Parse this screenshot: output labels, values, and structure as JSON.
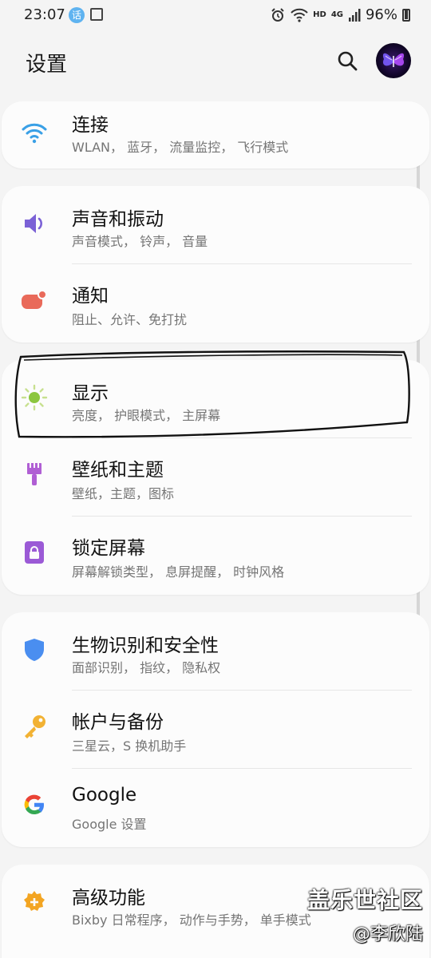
{
  "status": {
    "time": "23:07",
    "battery": "96%",
    "network_labels": [
      "HD",
      "4G"
    ]
  },
  "header": {
    "title": "设置"
  },
  "cards": [
    {
      "items": [
        {
          "label": "连接",
          "subtitle": "WLAN， 蓝牙， 流量监控， 飞行模式",
          "icon": "wifi-icon",
          "icon_color": "#3aa0e6"
        }
      ]
    },
    {
      "items": [
        {
          "label": "声音和振动",
          "subtitle": "声音模式， 铃声， 音量",
          "icon": "speaker-icon",
          "icon_color": "#7b61d6"
        },
        {
          "label": "通知",
          "subtitle": "阻止、允许、免打扰",
          "icon": "notification-icon",
          "icon_color": "#e96a5a"
        }
      ]
    },
    {
      "items": [
        {
          "label": "显示",
          "subtitle": "亮度， 护眼模式， 主屏幕",
          "icon": "brightness-icon",
          "icon_color": "#8cc63f"
        },
        {
          "label": "壁纸和主题",
          "subtitle": "壁纸，主题，图标",
          "icon": "paintbrush-icon",
          "icon_color": "#b05fd4"
        },
        {
          "label": "锁定屏幕",
          "subtitle": "屏幕解锁类型， 息屏提醒， 时钟风格",
          "icon": "lock-icon",
          "icon_color": "#9b5ad6"
        }
      ]
    },
    {
      "items": [
        {
          "label": "生物识别和安全性",
          "subtitle": "面部识别， 指纹， 隐私权",
          "icon": "shield-icon",
          "icon_color": "#4a8ef0"
        },
        {
          "label": "帐户与备份",
          "subtitle": "三星云，S 换机助手",
          "icon": "key-icon",
          "icon_color": "#f2b233"
        },
        {
          "label": "Google",
          "subtitle": "Google 设置",
          "icon": "google-icon",
          "icon_color": "#4285f4"
        }
      ]
    },
    {
      "items": [
        {
          "label": "高级功能",
          "subtitle": "Bixby 日常程序， 动作与手势， 单手模式",
          "icon": "gear-plus-icon",
          "icon_color": "#f3a522"
        }
      ]
    }
  ],
  "watermark": {
    "line1": "盖乐世社区",
    "line2": "@李欣陆"
  }
}
